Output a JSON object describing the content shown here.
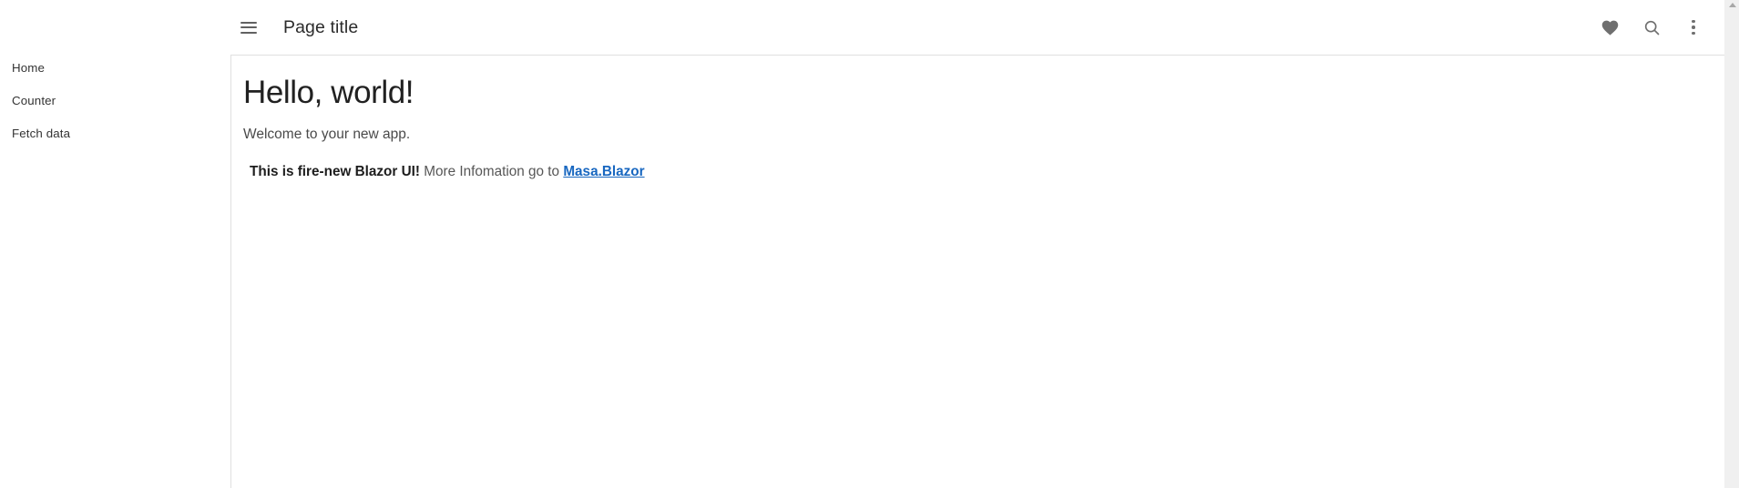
{
  "app": {
    "background": "#ffffff",
    "accent": "#1867c0"
  },
  "appbar": {
    "menu_icon": "hamburger-menu-icon",
    "title": "Page title",
    "actions": [
      {
        "name": "favorite-icon",
        "label": "Favorite"
      },
      {
        "name": "search-icon",
        "label": "Search"
      },
      {
        "name": "more-vert-icon",
        "label": "More options"
      }
    ]
  },
  "sidebar": {
    "items": [
      {
        "label": "Home",
        "icon": "home-icon"
      },
      {
        "label": "Counter",
        "icon": "counter-icon"
      },
      {
        "label": "Fetch data",
        "icon": "list-icon"
      }
    ]
  },
  "main": {
    "heading": "Hello, world!",
    "subheading": "Welcome to your new app.",
    "alert": {
      "bold_text": "This is fire-new Blazor UI!",
      "plain_text": " More Infomation go to ",
      "link_text": "Masa.Blazor"
    }
  },
  "scrollbar": {
    "name": "vertical-scrollbar",
    "position": "right"
  }
}
